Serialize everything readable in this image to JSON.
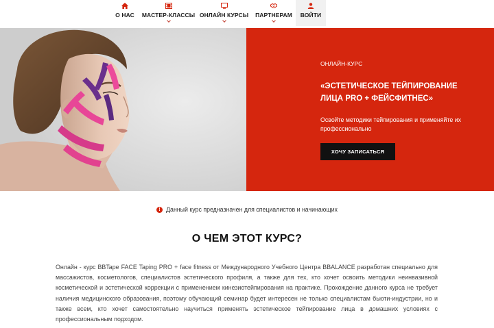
{
  "nav": {
    "items": [
      {
        "label": "О НАС",
        "icon": "home-icon"
      },
      {
        "label": "МАСТЕР-КЛАССЫ",
        "icon": "film-icon"
      },
      {
        "label": "ОНЛАЙН КУРСЫ",
        "icon": "monitor-icon"
      },
      {
        "label": "ПАРТНЕРАМ",
        "icon": "handshake-icon"
      },
      {
        "label": "ВОЙТИ",
        "icon": "user-icon"
      }
    ],
    "accent_color": "#d5260e"
  },
  "hero": {
    "course_tag": "ОНЛАЙН-КУРС",
    "title": "«ЭСТЕТИЧЕСКОЕ ТЕЙПИРОВАНИЕ ЛИЦА PRO + ФЕЙСФИТНЕС»",
    "description": "Освойте методики тейпирования и применяйте их профессионально",
    "cta_label": "ХОЧУ ЗАПИСАТЬСЯ",
    "background_color": "#d5260e",
    "photo": "woman-with-face-tape"
  },
  "notice": {
    "icon": "info-icon",
    "text": "Данный курс предназначен для специалистов и начинающих"
  },
  "section": {
    "title": "О ЧЕМ ЭТОТ КУРС?",
    "body": "Онлайн - курс BBTape FACE Taping PRO + face fitness от Международного Учебного Центра BBALANCE разработан специально для массажистов, косметологов, специалистов эстетического профиля, а также для тех, кто хочет освоить методики неинвазивной косметической и эстетической коррекции с применением кинезиотейпирования на практике. Прохождение данного курса не требует наличия медицинского образования, поэтому обучающий семинар будет интересен не только специалистам бьюти-индустрии, но и также всем, кто хочет самостоятельно научиться применять эстетическое тейпирование лица в домашних условиях с профессиональным подходом."
  }
}
